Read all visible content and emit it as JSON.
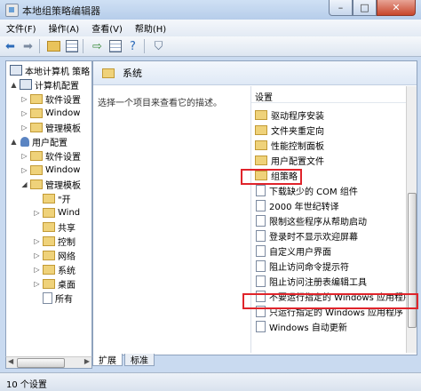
{
  "window": {
    "title": "本地组策略编辑器",
    "buttons": {
      "minimize": "–",
      "maximize": "□",
      "close": "✕"
    }
  },
  "menu": [
    "文件(F)",
    "操作(A)",
    "查看(V)",
    "帮助(H)"
  ],
  "tree": {
    "items": [
      {
        "label": "本地计算机 策略",
        "toggle": "",
        "icon": "computer"
      },
      {
        "label": "计算机配置",
        "toggle": "▲",
        "icon": "computer"
      },
      {
        "label": "软件设置",
        "toggle": "▷",
        "icon": "folder"
      },
      {
        "label": "Window",
        "toggle": "▷",
        "icon": "folder"
      },
      {
        "label": "管理模板",
        "toggle": "▷",
        "icon": "folder"
      },
      {
        "label": "用户配置",
        "toggle": "▲",
        "icon": "user"
      },
      {
        "label": "软件设置",
        "toggle": "▷",
        "icon": "folder"
      },
      {
        "label": "Window",
        "toggle": "▷",
        "icon": "folder"
      },
      {
        "label": "管理模板",
        "toggle": "◢",
        "icon": "folder"
      },
      {
        "label": "\"开",
        "toggle": "",
        "icon": "folder"
      },
      {
        "label": "Wind",
        "toggle": "▷",
        "icon": "folder"
      },
      {
        "label": "共享",
        "toggle": "",
        "icon": "folder"
      },
      {
        "label": "控制",
        "toggle": "▷",
        "icon": "folder"
      },
      {
        "label": "网络",
        "toggle": "▷",
        "icon": "folder"
      },
      {
        "label": "系统",
        "toggle": "▷",
        "icon": "folder"
      },
      {
        "label": "桌面",
        "toggle": "▷",
        "icon": "folder"
      },
      {
        "label": "所有",
        "toggle": "",
        "icon": "doc"
      }
    ]
  },
  "header": {
    "title": "系统"
  },
  "description": "选择一个项目来查看它的描述。",
  "list": {
    "column": "设置",
    "items": [
      {
        "label": "驱动程序安装",
        "icon": "folder"
      },
      {
        "label": "文件夹重定向",
        "icon": "folder"
      },
      {
        "label": "性能控制面板",
        "icon": "folder"
      },
      {
        "label": "用户配置文件",
        "icon": "folder"
      },
      {
        "label": "组策略",
        "icon": "folder"
      },
      {
        "label": "下载缺少的 COM 组件",
        "icon": "doc"
      },
      {
        "label": "2000 年世纪转译",
        "icon": "doc"
      },
      {
        "label": "限制这些程序从帮助启动",
        "icon": "doc"
      },
      {
        "label": "登录时不显示欢迎屏幕",
        "icon": "doc"
      },
      {
        "label": "自定义用户界面",
        "icon": "doc"
      },
      {
        "label": "阻止访问命令提示符",
        "icon": "doc"
      },
      {
        "label": "阻止访问注册表编辑工具",
        "icon": "doc"
      },
      {
        "label": "不要运行指定的 Windows 应用程序",
        "icon": "doc"
      },
      {
        "label": "只运行指定的 Windows 应用程序",
        "icon": "doc"
      },
      {
        "label": "Windows 自动更新",
        "icon": "doc"
      }
    ]
  },
  "tabs": [
    "扩展",
    "标准"
  ],
  "status": "10 个设置",
  "colors": {
    "highlight": "#e0242b",
    "titlebar": "#b6cdea"
  }
}
